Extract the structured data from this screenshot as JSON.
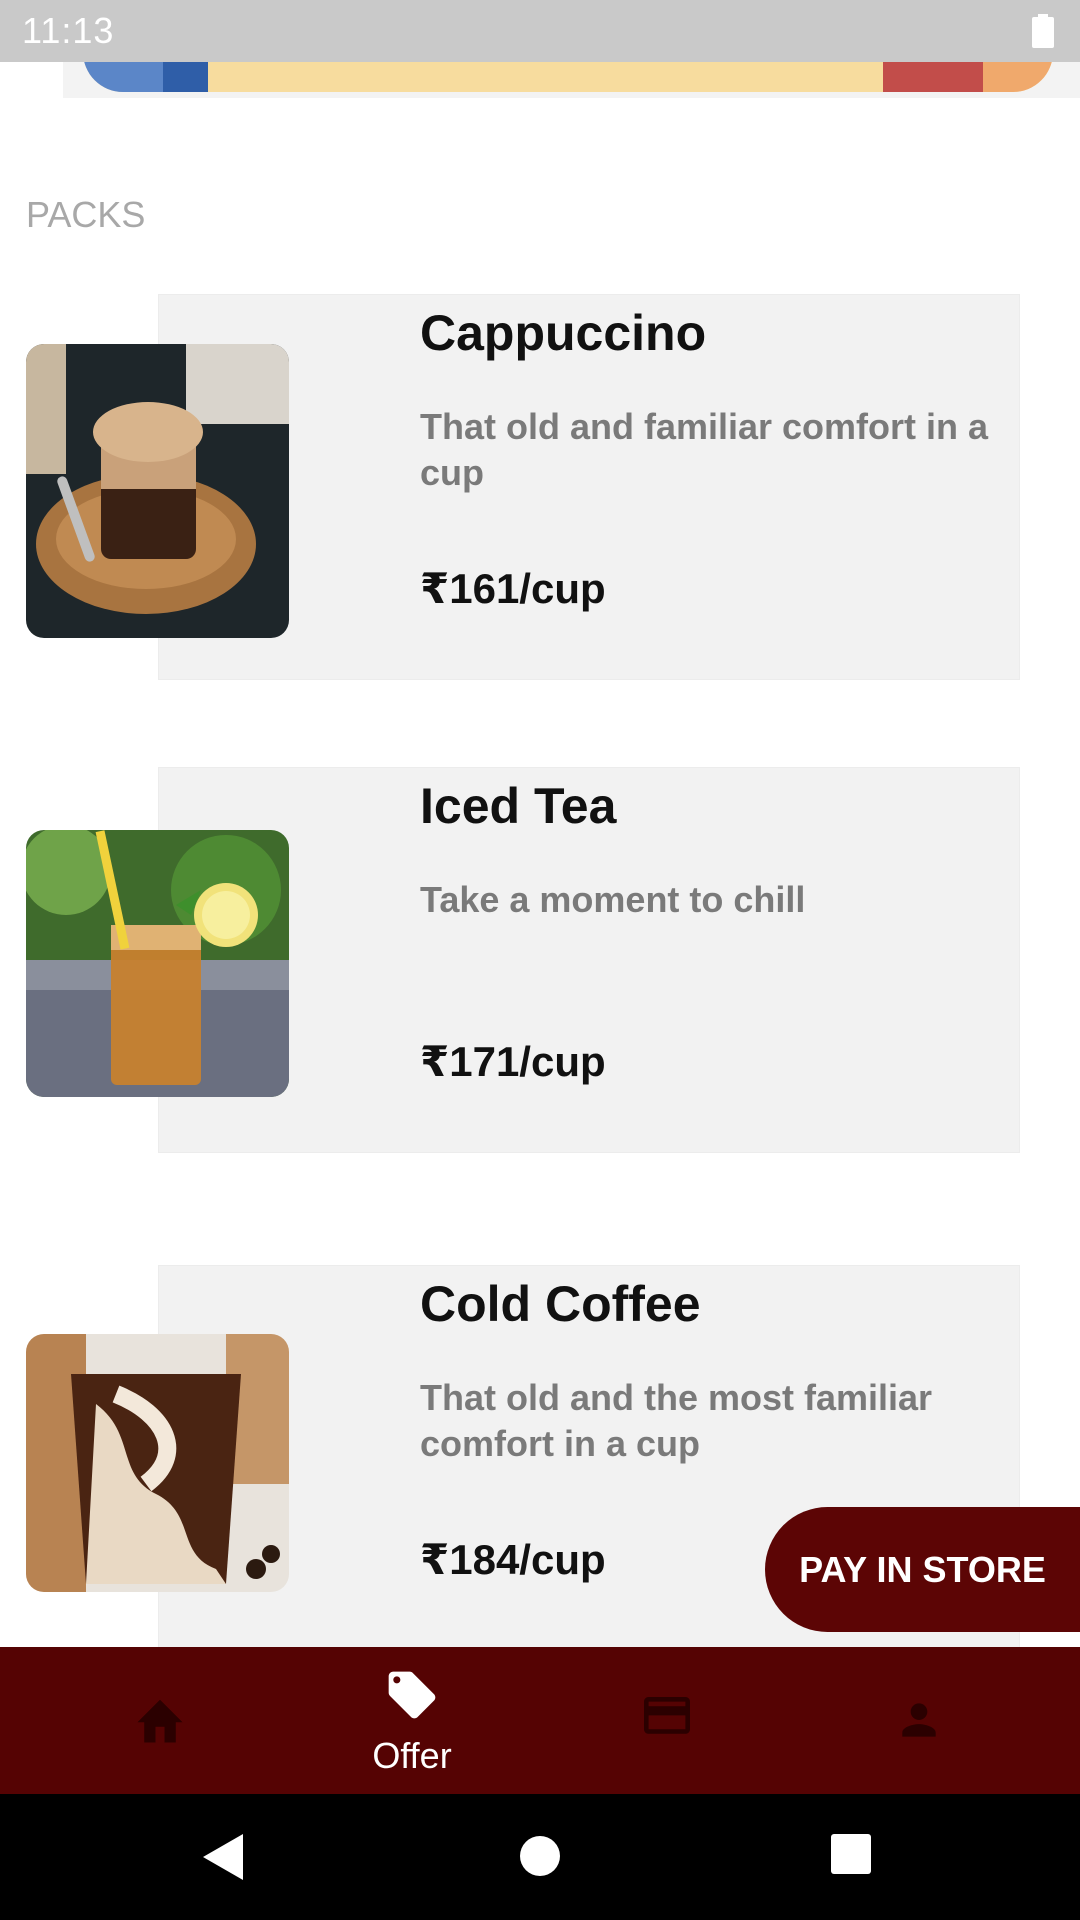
{
  "status_bar": {
    "time": "11:13"
  },
  "section": {
    "title": "PACKS"
  },
  "packs": [
    {
      "name": "Cappuccino",
      "description": "That old and familiar comfort in a cup",
      "price": "₹161/cup"
    },
    {
      "name": "Iced Tea",
      "description": "Take a moment to chill",
      "price": "₹171/cup"
    },
    {
      "name": "Cold Coffee",
      "description": "That old and the most familiar comfort in a cup",
      "price": "₹184/cup"
    }
  ],
  "pay_button": {
    "label": "PAY IN STORE"
  },
  "bottom_nav": {
    "items": [
      {
        "icon": "home-icon",
        "label": ""
      },
      {
        "icon": "tag-icon",
        "label": "Offer"
      },
      {
        "icon": "card-icon",
        "label": ""
      },
      {
        "icon": "person-icon",
        "label": ""
      }
    ]
  },
  "colors": {
    "nav_bg": "#550303",
    "button_bg": "#5c0505",
    "card_bg": "#f2f2f2"
  }
}
